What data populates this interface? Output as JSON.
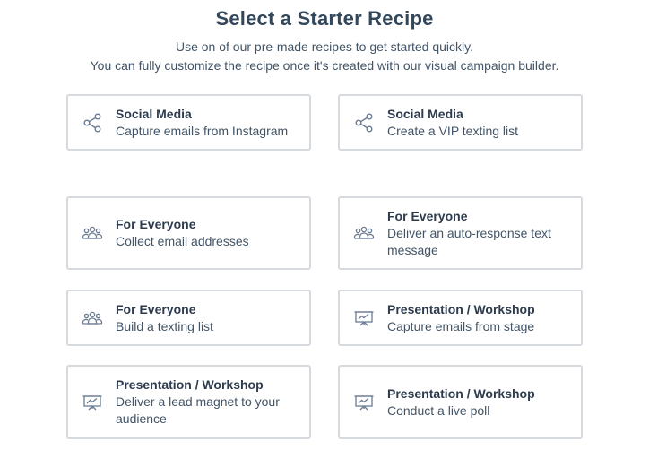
{
  "header": {
    "title": "Select a Starter Recipe",
    "subtitle_line1": "Use on of our pre-made recipes to get started quickly.",
    "subtitle_line2": "You can fully customize the recipe once it's created with our visual campaign builder."
  },
  "colors": {
    "text_dark": "#2d3b4e",
    "text_body": "#425466",
    "card_border": "#d6dadf",
    "icon_stroke": "#6b7c93"
  },
  "cards": [
    {
      "icon": "share-icon",
      "category": "Social Media",
      "description": "Capture emails from Instagram"
    },
    {
      "icon": "share-icon",
      "category": "Social Media",
      "description": "Create a VIP texting list"
    },
    {
      "icon": "group-icon",
      "category": "For Everyone",
      "description": "Collect email addresses"
    },
    {
      "icon": "group-icon",
      "category": "For Everyone",
      "description": "Deliver an auto-response text message"
    },
    {
      "icon": "group-icon",
      "category": "For Everyone",
      "description": "Build a texting list"
    },
    {
      "icon": "presentation-icon",
      "category": "Presentation / Workshop",
      "description": "Capture emails from stage"
    },
    {
      "icon": "presentation-icon",
      "category": "Presentation / Workshop",
      "description": "Deliver a lead magnet to your audience"
    },
    {
      "icon": "presentation-icon",
      "category": "Presentation / Workshop",
      "description": "Conduct a live poll"
    }
  ]
}
